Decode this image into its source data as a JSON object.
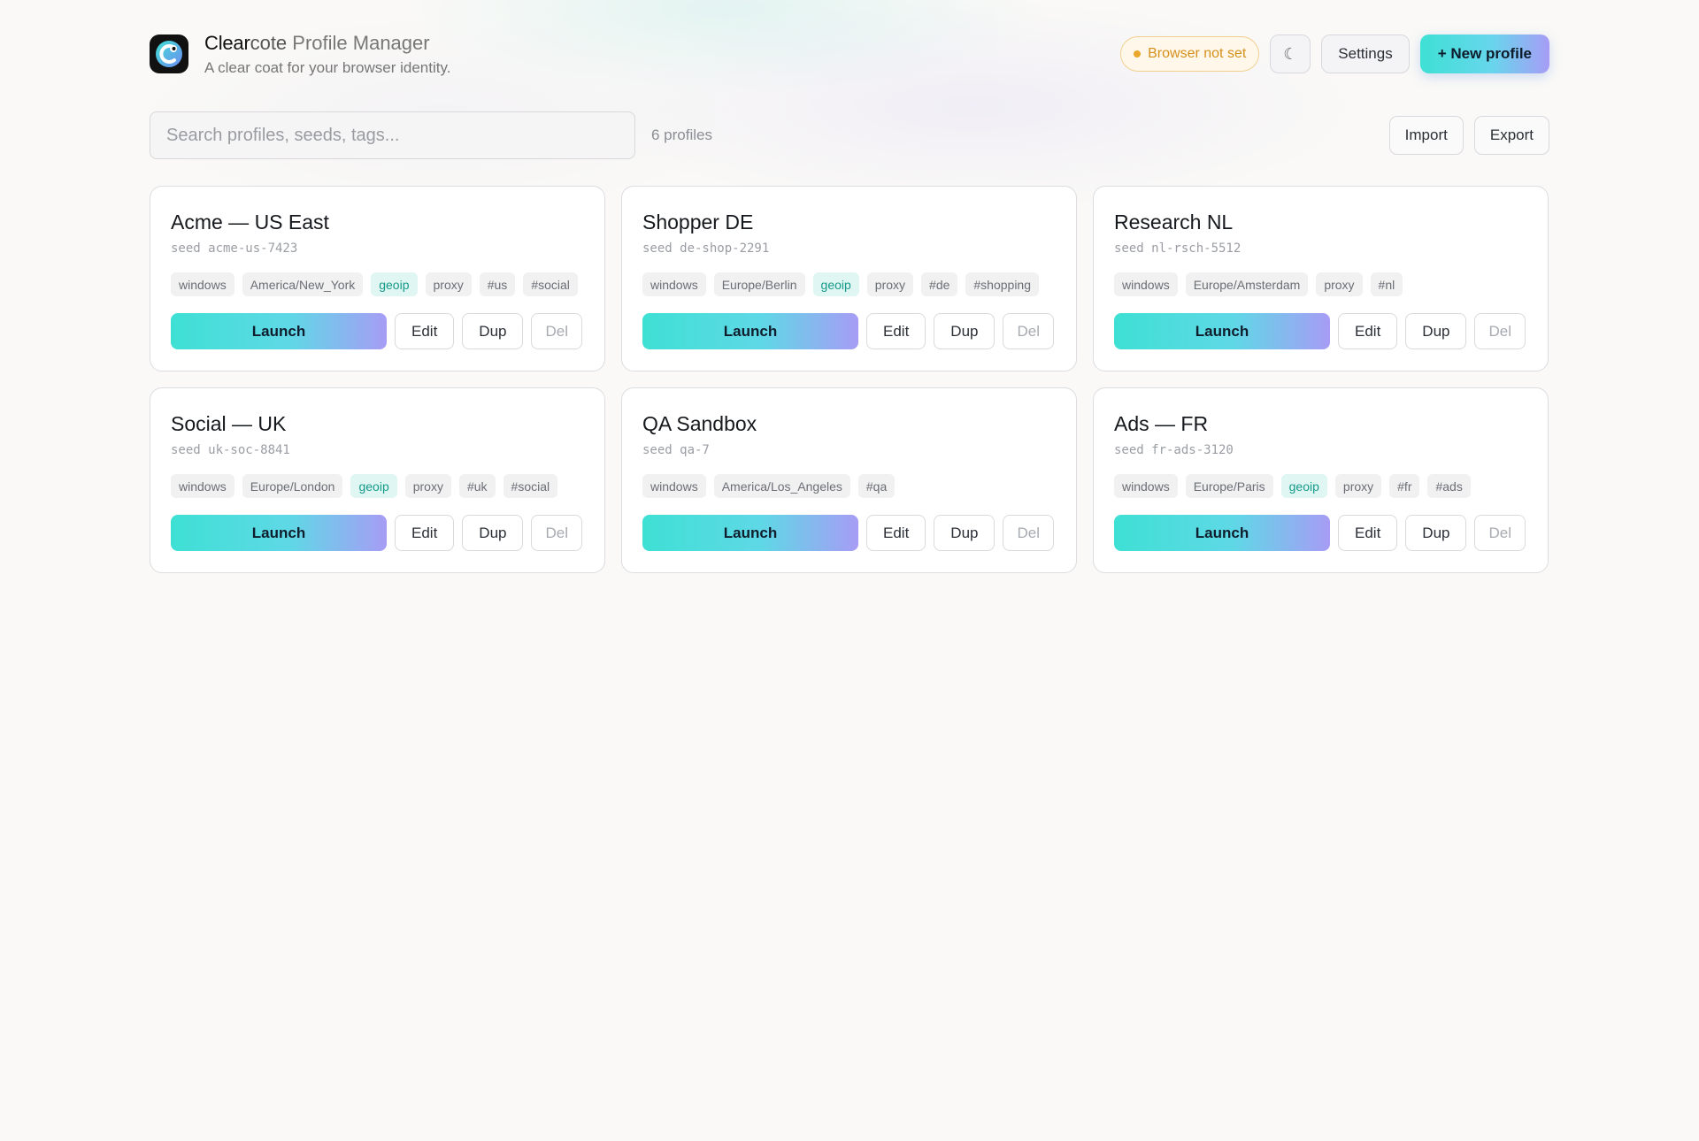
{
  "header": {
    "title_strong": "Clear",
    "title_mid": "cote",
    "title_light": " Profile Manager",
    "tagline": "A clear coat for your browser identity.",
    "browser_status": "Browser not set",
    "theme_toggle_glyph": "☾",
    "settings_label": "Settings",
    "new_profile_label": "+ New profile"
  },
  "toolbar": {
    "search_placeholder": "Search profiles, seeds, tags...",
    "profile_count": "6 profiles",
    "import_label": "Import",
    "export_label": "Export"
  },
  "actions": {
    "launch": "Launch",
    "edit": "Edit",
    "dup": "Dup",
    "del": "Del"
  },
  "profiles": [
    {
      "name": "Acme — US East",
      "seed": "seed acme-us-7423",
      "tags": [
        "windows",
        "America/New_York",
        "geoip",
        "proxy",
        "#us",
        "#social"
      ]
    },
    {
      "name": "Shopper DE",
      "seed": "seed de-shop-2291",
      "tags": [
        "windows",
        "Europe/Berlin",
        "geoip",
        "proxy",
        "#de",
        "#shopping"
      ]
    },
    {
      "name": "Research NL",
      "seed": "seed nl-rsch-5512",
      "tags": [
        "windows",
        "Europe/Amsterdam",
        "proxy",
        "#nl"
      ]
    },
    {
      "name": "Social — UK",
      "seed": "seed uk-soc-8841",
      "tags": [
        "windows",
        "Europe/London",
        "geoip",
        "proxy",
        "#uk",
        "#social"
      ]
    },
    {
      "name": "QA Sandbox",
      "seed": "seed qa-7",
      "tags": [
        "windows",
        "America/Los_Angeles",
        "#qa"
      ]
    },
    {
      "name": "Ads — FR",
      "seed": "seed fr-ads-3120",
      "tags": [
        "windows",
        "Europe/Paris",
        "geoip",
        "proxy",
        "#fr",
        "#ads"
      ]
    }
  ],
  "colors": {
    "accent_start": "#3ee0d4",
    "accent_end": "#a79cf5",
    "warning": "#eca62c",
    "geoip_tag": "#169a8a"
  }
}
